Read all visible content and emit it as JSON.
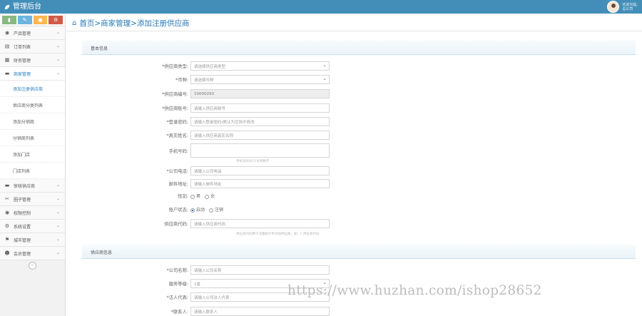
{
  "app": {
    "title": "管理后台",
    "user_greeting": "欢迎光临,",
    "user_name": "总公司"
  },
  "shortcuts": [
    "chart-icon",
    "pencil-icon",
    "users-icon",
    "gear-icon"
  ],
  "sidebar": {
    "items": [
      {
        "label": "产品管理",
        "icon": "product-icon"
      },
      {
        "label": "订单列表",
        "icon": "order-icon"
      },
      {
        "label": "财务管理",
        "icon": "finance-icon"
      },
      {
        "label": "商家管理",
        "icon": "merchant-icon",
        "active": true
      }
    ],
    "sub_items": [
      "添加注册供应商",
      "供应商分类列表",
      "添加分销商",
      "分销商列表",
      "添加门店",
      "门店列表"
    ],
    "items_after": [
      {
        "label": "审核供应商",
        "icon": "audit-icon"
      },
      {
        "label": "圈子管理",
        "icon": "circle-icon"
      },
      {
        "label": "权限控制",
        "icon": "permission-icon"
      },
      {
        "label": "系统设置",
        "icon": "settings-icon"
      },
      {
        "label": "城市管理",
        "icon": "city-icon"
      },
      {
        "label": "会员管理",
        "icon": "member-icon"
      }
    ],
    "collapse_glyph": "«"
  },
  "breadcrumb": "首页>商家管理>添加注册供应商",
  "sections": {
    "basic": "基本信息",
    "supplier": "供应商信息"
  },
  "form": {
    "supplier_type": {
      "label": "*供应商类型:",
      "value": "请选择供应商类型"
    },
    "currency": {
      "label": "*币种:",
      "value": "请选择币种"
    },
    "supplier_no": {
      "label": "*供应商编号:",
      "value": "10000293"
    },
    "account": {
      "label": "*供应商账号:",
      "placeholder": "请输入供应商账号"
    },
    "password": {
      "label": "*登录密码:",
      "placeholder": "请输入登录密码(默认为空则不修改"
    },
    "real_name": {
      "label": "*真实姓名:",
      "placeholder": "请输入供应商真实名称"
    },
    "phone": {
      "label": "手机号码:",
      "placeholder": "",
      "hint": "手机号码为11位纯数字"
    },
    "company_phone": {
      "label": "*公司电话:",
      "placeholder": "请输入公司电话"
    },
    "email": {
      "label": "邮件地址:",
      "placeholder": "请输入邮件地址"
    },
    "gender": {
      "label": "性别:",
      "options": [
        "男",
        "女"
      ]
    },
    "account_status": {
      "label": "账户状态:",
      "options": [
        "启动",
        "注销"
      ]
    },
    "supplier_code": {
      "label": "供应商代码:",
      "placeholder": "请输入供应商代码",
      "hint": "供应商代码用于流量统计中识别供应商，如：F 供应商代码"
    },
    "company_name": {
      "label": "*公司名称:",
      "placeholder": "请输入公司名称"
    },
    "service_level": {
      "label": "服务等级:",
      "value": "1星"
    },
    "legal_rep": {
      "label": "*法人代表:",
      "placeholder": "请输入公司法人代表"
    },
    "contact": {
      "label": "*联系人:",
      "placeholder": "请输入联系人"
    }
  },
  "watermark": "https://www.huzhan.com/ishop28652"
}
